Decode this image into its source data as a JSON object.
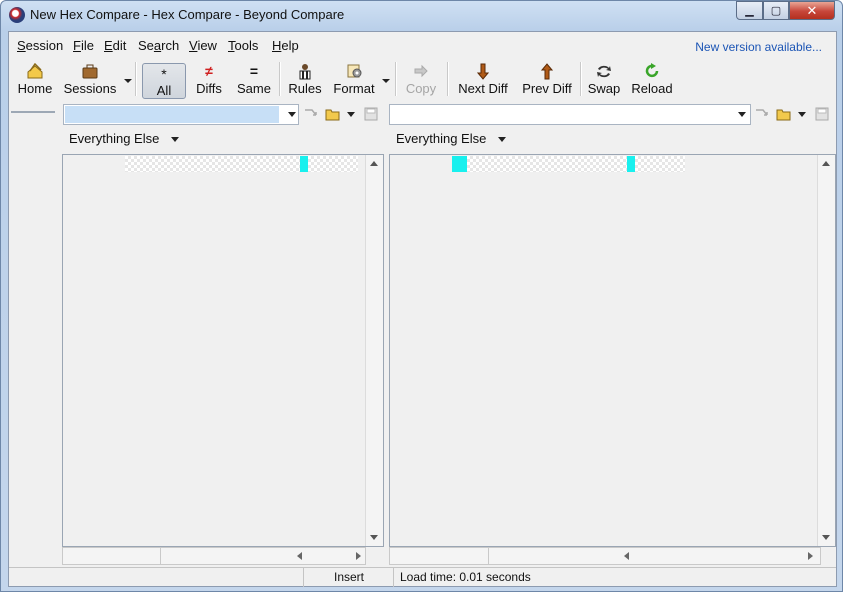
{
  "window": {
    "title": "New Hex Compare - Hex Compare - Beyond Compare",
    "minimize_glyph": "▁",
    "maximize_glyph": "▢",
    "close_glyph": "✕"
  },
  "menubar": {
    "items": [
      {
        "pre": "",
        "u": "S",
        "post": "ession"
      },
      {
        "pre": "",
        "u": "F",
        "post": "ile"
      },
      {
        "pre": "",
        "u": "E",
        "post": "dit"
      },
      {
        "pre": "Se",
        "u": "a",
        "post": "rch"
      },
      {
        "pre": "",
        "u": "V",
        "post": "iew"
      },
      {
        "pre": "",
        "u": "T",
        "post": "ools"
      },
      {
        "pre": "",
        "u": "H",
        "post": "elp"
      }
    ],
    "new_version_link": "New version available..."
  },
  "toolbar": {
    "home": "Home",
    "sessions": "Sessions",
    "all": "All",
    "diffs": "Diffs",
    "same": "Same",
    "rules": "Rules",
    "format": "Format",
    "copy": "Copy",
    "next_diff": "Next Diff",
    "prev_diff": "Prev Diff",
    "swap": "Swap",
    "reload": "Reload",
    "all_glyph": "*",
    "diffs_glyph": "≠",
    "same_glyph": "="
  },
  "left_pane": {
    "path_value": "",
    "format_label": "Everything Else"
  },
  "right_pane": {
    "path_value": "",
    "format_label": "Everything Else"
  },
  "statusbar": {
    "mode": "Insert",
    "load_time": "Load time: 0.01 seconds"
  },
  "colors": {
    "diff_highlight": "#19f0ee",
    "link": "#1c55b5"
  }
}
